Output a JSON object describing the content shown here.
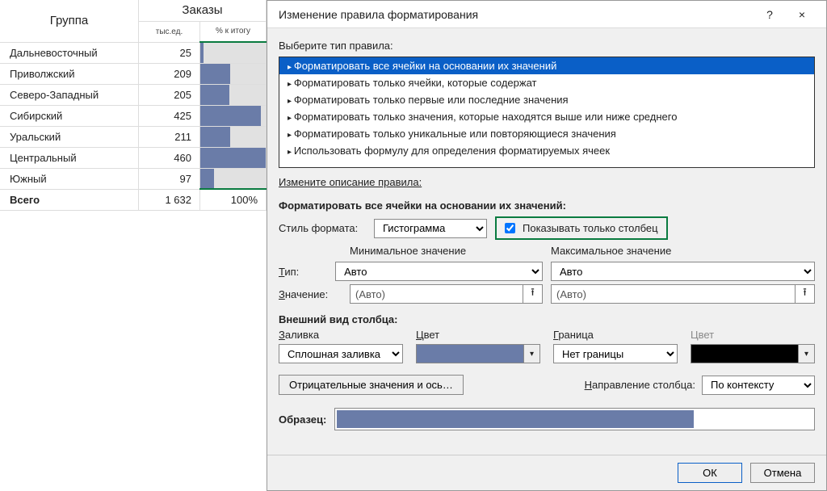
{
  "sheet": {
    "headers": {
      "group": "Группа",
      "orders": "Заказы",
      "sub1": "тыс.ед.",
      "sub2": "% к итогу"
    },
    "rows": [
      {
        "name": "Дальневосточный",
        "value": "25",
        "pct": 5.4
      },
      {
        "name": "Приволжский",
        "value": "209",
        "pct": 45.4
      },
      {
        "name": "Северо-Западный",
        "value": "205",
        "pct": 44.6
      },
      {
        "name": "Сибирский",
        "value": "425",
        "pct": 92.4
      },
      {
        "name": "Уральский",
        "value": "211",
        "pct": 45.9
      },
      {
        "name": "Центральный",
        "value": "460",
        "pct": 100
      },
      {
        "name": "Южный",
        "value": "97",
        "pct": 21.1
      }
    ],
    "total": {
      "name": "Всего",
      "value": "1 632",
      "pct_text": "100%"
    }
  },
  "dialog": {
    "title": "Изменение правила форматирования",
    "help": "?",
    "close": "×",
    "ruleTypeLabel": "Выберите тип правила:",
    "ruleTypes": [
      "Форматировать все ячейки на основании их значений",
      "Форматировать только ячейки, которые содержат",
      "Форматировать только первые или последние значения",
      "Форматировать только значения, которые находятся выше или ниже среднего",
      "Форматировать только уникальные или повторяющиеся значения",
      "Использовать формулу для определения форматируемых ячеек"
    ],
    "editDescLabel": "Измените описание правила:",
    "formatAll": "Форматировать все ячейки на основании их значений:",
    "styleLabel": "Стиль формата:",
    "styleValue": "Гистограмма",
    "showBarOnly": "Показывать только столбец",
    "min": {
      "title": "Минимальное значение",
      "typeLabel": "Тип:",
      "typeValue": "Авто",
      "valLabel": "Значение:",
      "valValue": "(Авто)"
    },
    "max": {
      "title": "Максимальное значение",
      "typeValue": "Авто",
      "valValue": "(Авто)"
    },
    "barLook": "Внешний вид столбца:",
    "fill": {
      "label": "Заливка",
      "value": "Сплошная заливка"
    },
    "color": {
      "label": "Цвет",
      "hex": "#6a7ca8"
    },
    "border": {
      "label": "Граница",
      "value": "Нет границы"
    },
    "bcolor": {
      "label": "Цвет",
      "hex": "#000000"
    },
    "negBtn": "Отрицательные значения и ось…",
    "dirLabel": "Направление столбца:",
    "dirValue": "По контексту",
    "preview": "Образец:",
    "ok": "ОК",
    "cancel": "Отмена"
  }
}
